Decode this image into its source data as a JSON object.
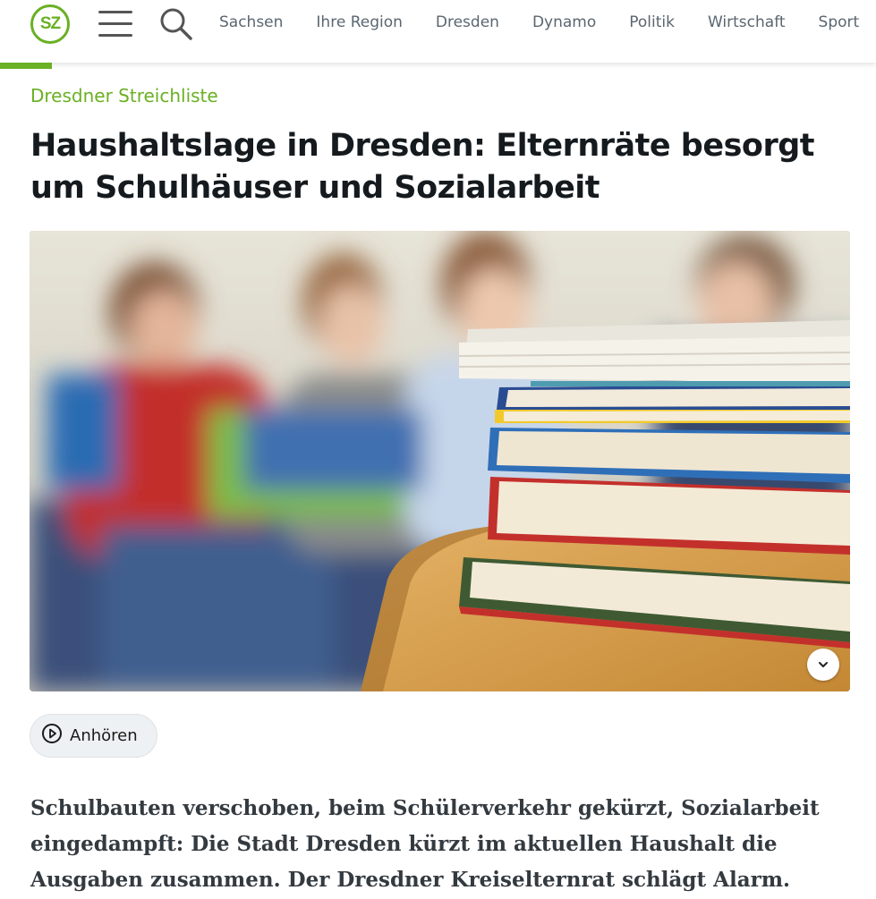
{
  "header": {
    "logo_text": "SZ",
    "nav": [
      "Sachsen",
      "Ihre Region",
      "Dresden",
      "Dynamo",
      "Politik",
      "Wirtschaft",
      "Sport"
    ],
    "brand_color": "#6ab023"
  },
  "article": {
    "kicker": "Dresdner Streichliste",
    "headline": "Haushaltslage in Dresden: Elternräte besorgt um Schulhäuser und Sozialarbeit",
    "listen_label": "Anhören",
    "lead": "Schulbauten verschoben, beim Schülerverkehr gekürzt, Sozialarbeit eingedampft: Die Stadt Dresden kürzt im aktuellen Haushalt die Ausgaben zusammen. Der Dresdner Kreiselternrat schlägt Alarm."
  },
  "icons": {
    "menu": "hamburger-menu-icon",
    "search": "search-icon",
    "play": "play-circle-icon",
    "expand": "chevron-down-icon"
  }
}
